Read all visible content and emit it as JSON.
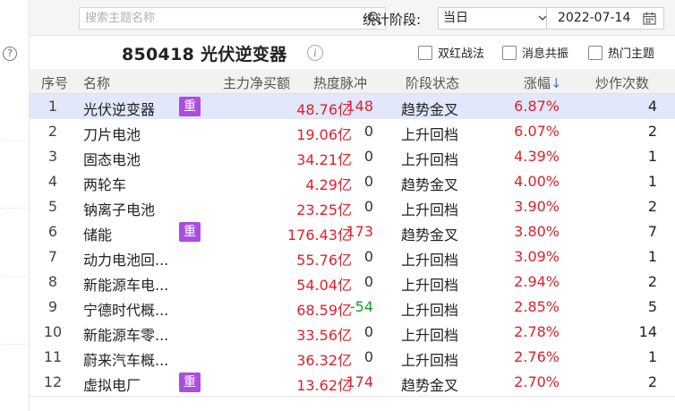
{
  "search": {
    "placeholder": "搜索主题名称"
  },
  "stage": {
    "label": "统计阶段:",
    "value": "当日"
  },
  "date": {
    "value": "2022-07-14"
  },
  "help_icon_glyph": "?",
  "info_icon_glyph": "i",
  "board": {
    "title": "850418 光伏逆变器"
  },
  "options": [
    {
      "label": "双红战法",
      "checked": false
    },
    {
      "label": "消息共振",
      "checked": false
    },
    {
      "label": "热门主题",
      "checked": false
    }
  ],
  "columns": {
    "idx": "序号",
    "name": "名称",
    "buy": "主力净买额",
    "heat": "热度脉冲",
    "state": "阶段状态",
    "chg": "涨幅",
    "chg_sort": "↓",
    "cnt": "炒作次数"
  },
  "badge_text": "重",
  "accent_color": "#e0202a",
  "badge_color": "#a94ee0",
  "rows": [
    {
      "idx": "1",
      "name": "光伏逆变器",
      "badge": true,
      "buy": "48.76亿",
      "heat": "148",
      "heat_type": "red",
      "state": "趋势金叉",
      "chg": "6.87%",
      "cnt": "4",
      "selected": true
    },
    {
      "idx": "2",
      "name": "刀片电池",
      "badge": false,
      "buy": "19.06亿",
      "heat": "0",
      "heat_type": "zero",
      "state": "上升回档",
      "chg": "6.07%",
      "cnt": "2",
      "selected": false
    },
    {
      "idx": "3",
      "name": "固态电池",
      "badge": false,
      "buy": "34.21亿",
      "heat": "0",
      "heat_type": "zero",
      "state": "上升回档",
      "chg": "4.39%",
      "cnt": "1",
      "selected": false
    },
    {
      "idx": "4",
      "name": "两轮车",
      "badge": false,
      "buy": "4.29亿",
      "heat": "0",
      "heat_type": "zero",
      "state": "趋势金叉",
      "chg": "4.00%",
      "cnt": "1",
      "selected": false
    },
    {
      "idx": "5",
      "name": "钠离子电池",
      "badge": false,
      "buy": "23.25亿",
      "heat": "0",
      "heat_type": "zero",
      "state": "上升回档",
      "chg": "3.90%",
      "cnt": "2",
      "selected": false
    },
    {
      "idx": "6",
      "name": "储能",
      "badge": true,
      "buy": "176.43亿",
      "heat": "173",
      "heat_type": "red",
      "state": "趋势金叉",
      "chg": "3.80%",
      "cnt": "7",
      "selected": false
    },
    {
      "idx": "7",
      "name": "动力电池回...",
      "badge": false,
      "buy": "55.76亿",
      "heat": "0",
      "heat_type": "zero",
      "state": "上升回档",
      "chg": "3.09%",
      "cnt": "1",
      "selected": false
    },
    {
      "idx": "8",
      "name": "新能源车电...",
      "badge": false,
      "buy": "54.04亿",
      "heat": "0",
      "heat_type": "zero",
      "state": "上升回档",
      "chg": "2.94%",
      "cnt": "2",
      "selected": false
    },
    {
      "idx": "9",
      "name": "宁德时代概...",
      "badge": false,
      "buy": "68.59亿",
      "heat": "-54",
      "heat_type": "green",
      "state": "上升回档",
      "chg": "2.85%",
      "cnt": "5",
      "selected": false
    },
    {
      "idx": "10",
      "name": "新能源车零...",
      "badge": false,
      "buy": "33.56亿",
      "heat": "0",
      "heat_type": "zero",
      "state": "上升回档",
      "chg": "2.78%",
      "cnt": "14",
      "selected": false
    },
    {
      "idx": "11",
      "name": "蔚来汽车概...",
      "badge": false,
      "buy": "36.32亿",
      "heat": "0",
      "heat_type": "zero",
      "state": "上升回档",
      "chg": "2.76%",
      "cnt": "1",
      "selected": false
    },
    {
      "idx": "12",
      "name": "虚拟电厂",
      "badge": true,
      "buy": "13.62亿",
      "heat": "174",
      "heat_type": "red",
      "state": "趋势金叉",
      "chg": "2.70%",
      "cnt": "2",
      "selected": false
    }
  ]
}
